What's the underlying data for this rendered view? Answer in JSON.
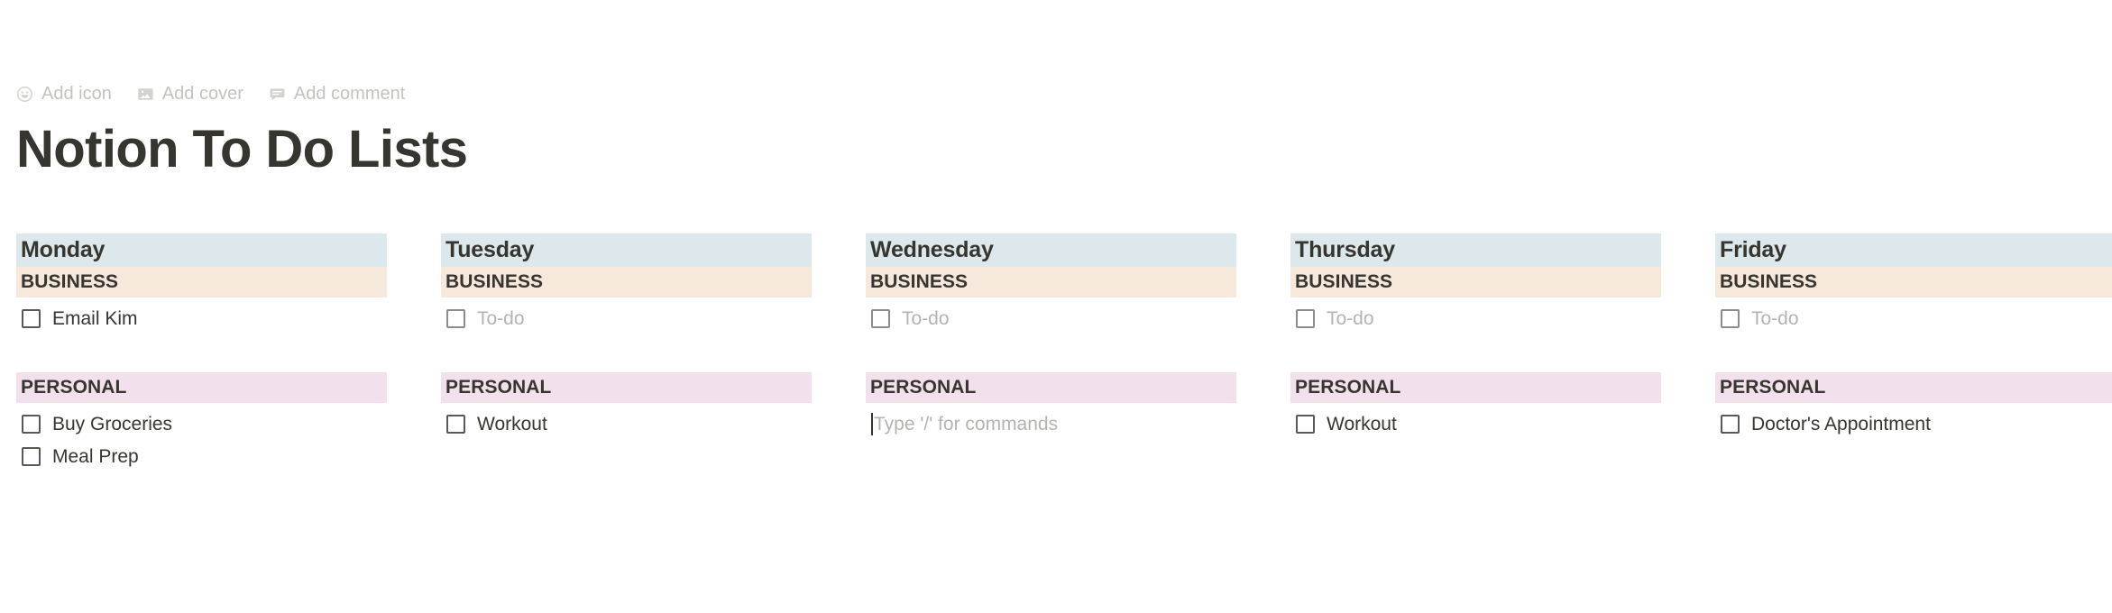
{
  "page": {
    "title": "Notion To Do Lists",
    "controls": [
      {
        "label": "Add icon",
        "icon": "smiley-face-icon"
      },
      {
        "label": "Add cover",
        "icon": "image-icon"
      },
      {
        "label": "Add comment",
        "icon": "comment-bubble-icon"
      }
    ]
  },
  "colors": {
    "day_band": "#dde8ec",
    "business_band": "#f7e8dc",
    "personal_band": "#f2e1ec",
    "text": "#37352f",
    "placeholder_text": "#b4b3b0",
    "control_text": "#c3c2bf"
  },
  "section_labels": {
    "business": "BUSINESS",
    "personal": "PERSONAL"
  },
  "placeholders": {
    "todo": "To-do",
    "command": "Type '/' for commands"
  },
  "columns": [
    {
      "day": "Monday",
      "business_label": "BUSINESS",
      "business_items": [
        {
          "text": "Email Kim",
          "checked": false,
          "empty": false
        }
      ],
      "personal_label": "PERSONAL",
      "personal_items": [
        {
          "text": "Buy Groceries",
          "checked": false,
          "empty": false
        },
        {
          "text": "Meal Prep",
          "checked": false,
          "empty": false
        }
      ]
    },
    {
      "day": "Tuesday",
      "business_label": "BUSINESS",
      "business_items": [
        {
          "text": "To-do",
          "checked": false,
          "empty": true
        }
      ],
      "personal_label": "PERSONAL",
      "personal_items": [
        {
          "text": "Workout",
          "checked": false,
          "empty": false
        }
      ]
    },
    {
      "day": "Wednesday",
      "business_label": "BUSINESS",
      "business_items": [
        {
          "text": "To-do",
          "checked": false,
          "empty": true
        }
      ],
      "personal_label": "PERSONAL",
      "personal_items": [],
      "personal_active_block": "Type '/' for commands"
    },
    {
      "day": "Thursday",
      "business_label": "BUSINESS",
      "business_items": [
        {
          "text": "To-do",
          "checked": false,
          "empty": true
        }
      ],
      "personal_label": "PERSONAL",
      "personal_items": [
        {
          "text": "Workout",
          "checked": false,
          "empty": false
        }
      ]
    },
    {
      "day": "Friday",
      "business_label": "BUSINESS",
      "business_items": [
        {
          "text": "To-do",
          "checked": false,
          "empty": true
        }
      ],
      "personal_label": "PERSONAL",
      "personal_items": [
        {
          "text": "Doctor's Appointment",
          "checked": false,
          "empty": false
        }
      ]
    }
  ]
}
